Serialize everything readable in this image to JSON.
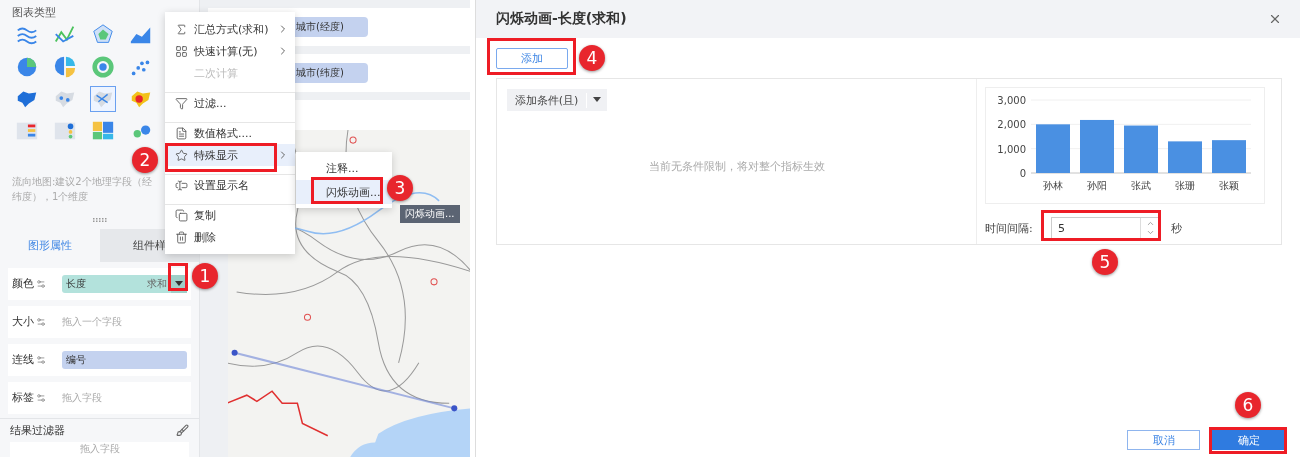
{
  "chart_types": {
    "title": "图表类型",
    "items": [
      {
        "kind": "line-multi",
        "selected": false
      },
      {
        "kind": "line",
        "selected": false
      },
      {
        "kind": "radar",
        "selected": false
      },
      {
        "kind": "area",
        "selected": false
      },
      {
        "kind": "pie",
        "selected": false
      },
      {
        "kind": "pie-split",
        "selected": false
      },
      {
        "kind": "ring",
        "selected": false
      },
      {
        "kind": "scatter",
        "selected": false
      },
      {
        "kind": "map-fill",
        "selected": false
      },
      {
        "kind": "map-dots",
        "selected": false
      },
      {
        "kind": "map-flow",
        "selected": true
      },
      {
        "kind": "map-heat",
        "selected": false
      },
      {
        "kind": "table-list",
        "selected": false
      },
      {
        "kind": "table-dots",
        "selected": false
      },
      {
        "kind": "treemap",
        "selected": false
      },
      {
        "kind": "word",
        "selected": false
      }
    ]
  },
  "hint": [
    "流向地图:建议2个地理字段（经",
    "纬度），1个维度"
  ],
  "property_tabs": [
    {
      "label": "图形属性",
      "selected": true
    },
    {
      "label": "组件样",
      "selected": false
    }
  ],
  "properties": [
    {
      "label": "颜色",
      "kind": "field",
      "field": "长度",
      "aggregation": "求和",
      "color": "#b3e2dc"
    },
    {
      "label": "大小",
      "kind": "empty",
      "placeholder": "拖入一个字段"
    },
    {
      "label": "连线",
      "kind": "field",
      "field": "编号",
      "color": "#c4d2ef"
    },
    {
      "label": "标签",
      "kind": "empty",
      "placeholder": "拖入字段"
    }
  ],
  "result_filter": {
    "title": "结果过滤器",
    "placeholder": "拖入字段"
  },
  "axis_fields": [
    {
      "field": "城市(经度)"
    },
    {
      "field": "城市(纬度)"
    }
  ],
  "context_menu": {
    "items": [
      {
        "kind": "sum",
        "label": "汇总方式(求和)",
        "submenu": true,
        "disabled": false,
        "selected": false,
        "divider_before": false
      },
      {
        "kind": "quick",
        "label": "快速计算(无)",
        "submenu": true,
        "disabled": false,
        "selected": false,
        "divider_before": false
      },
      {
        "kind": "plain",
        "label": "二次计算",
        "submenu": false,
        "disabled": true,
        "selected": false,
        "divider_before": false
      },
      {
        "kind": "filter",
        "label": "过滤...",
        "submenu": false,
        "disabled": false,
        "selected": false,
        "divider_before": true
      },
      {
        "kind": "format",
        "label": "数值格式....",
        "submenu": false,
        "disabled": false,
        "selected": false,
        "divider_before": true
      },
      {
        "kind": "star",
        "label": "特殊显示",
        "submenu": true,
        "disabled": false,
        "selected": true,
        "divider_before": false
      },
      {
        "kind": "rename",
        "label": "设置显示名",
        "submenu": false,
        "disabled": false,
        "selected": false,
        "divider_before": true
      },
      {
        "kind": "copy",
        "label": "复制",
        "submenu": false,
        "disabled": false,
        "selected": false,
        "divider_before": true
      },
      {
        "kind": "delete",
        "label": "删除",
        "submenu": false,
        "disabled": false,
        "selected": false,
        "divider_before": false
      }
    ]
  },
  "submenu": {
    "items": [
      {
        "label": "注释...",
        "selected": false
      },
      {
        "label": "闪烁动画...",
        "selected": true
      }
    ]
  },
  "tooltip": "闪烁动画...",
  "dialog": {
    "title": "闪烁动画-长度(求和)",
    "add_button": "添加",
    "condition_button": "添加条件(且)",
    "empty_message": "当前无条件限制，将对整个指标生效",
    "chart_data": {
      "type": "bar",
      "categories": [
        "孙林",
        "孙阳",
        "张武",
        "张珊",
        "张颖"
      ],
      "series": [
        {
          "color": "#4a90e2",
          "values": [
            2000,
            2180,
            1950,
            1300,
            1350
          ]
        }
      ],
      "ylim": [
        0,
        3000
      ],
      "yticks": [
        {
          "value": 0,
          "label": "0"
        },
        {
          "value": 1000,
          "label": "1,000"
        },
        {
          "value": 2000,
          "label": "2,000"
        },
        {
          "value": 3000,
          "label": "3,000"
        }
      ]
    },
    "interval": {
      "label": "时间间隔:",
      "value": "5",
      "unit": "秒"
    },
    "buttons": [
      {
        "label": "取消",
        "primary": false
      },
      {
        "label": "确定",
        "primary": true
      }
    ]
  },
  "callouts": [
    "1",
    "2",
    "3",
    "4",
    "5",
    "6"
  ]
}
